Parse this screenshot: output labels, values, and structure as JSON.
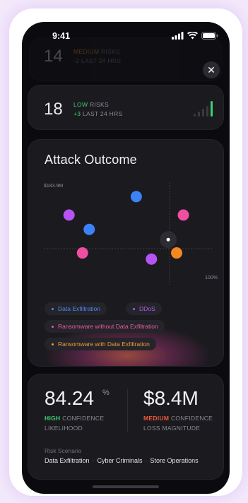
{
  "status_bar": {
    "time": "9:41"
  },
  "ghost_card": {
    "count": "14",
    "level": "MEDIUM",
    "suffix": "RISKS",
    "delta": "-2",
    "period": "LAST 24 HRS"
  },
  "low_card": {
    "count": "18",
    "level": "LOW",
    "suffix": "RISKS",
    "delta": "+3",
    "period": "LAST 24 HRS",
    "level_color": "#3ccf74"
  },
  "attack": {
    "title": "Attack Outcome",
    "y_label": "$183.9M",
    "x_label": "100%",
    "points": [
      {
        "series": "Data Exfiltration",
        "x": 0.55,
        "y": 0.86,
        "color": "#3b82f6"
      },
      {
        "series": "DDoS",
        "x": 0.15,
        "y": 0.68,
        "color": "#b653f5"
      },
      {
        "series": "Data Exfiltration",
        "x": 0.27,
        "y": 0.54,
        "color": "#3b82f6"
      },
      {
        "series": "Ransomware without Data Exfiltration",
        "x": 0.83,
        "y": 0.68,
        "color": "#ee4fa0"
      },
      {
        "series": "Ransomware without Data Exfiltration",
        "x": 0.23,
        "y": 0.31,
        "color": "#ee4fa0"
      },
      {
        "series": "DDoS",
        "x": 0.64,
        "y": 0.25,
        "color": "#b653f5"
      },
      {
        "series": "Ransomware with Data Exfiltration",
        "x": 0.79,
        "y": 0.31,
        "color": "#f5891f"
      }
    ],
    "marker": {
      "x": 0.74,
      "y": 0.44
    },
    "legend": [
      {
        "label": "Data Exfiltration",
        "color": "#4c8cf5"
      },
      {
        "label": "DDoS",
        "color": "#b35cf0"
      },
      {
        "label": "Ransomware without Data Exfiltration",
        "color": "#ec5aa6"
      },
      {
        "label": "Ransomware with Data Exfiltration",
        "color": "#f39a3a"
      }
    ]
  },
  "metrics": {
    "likelihood_value": "84.24",
    "likelihood_unit": "%",
    "likelihood_conf_level": "HIGH",
    "likelihood_conf_text": "CONFIDENCE",
    "likelihood_label": "LIKELIHOOD",
    "likelihood_color": "#3ccf74",
    "loss_value": "$8.4M",
    "loss_conf_level": "MEDIUM",
    "loss_conf_text": "CONFIDENCE",
    "loss_label": "LOSS MAGNITUDE",
    "loss_color": "#ef5a3c",
    "scenario_label": "Risk Scenario",
    "scenario_items": [
      "Data Exfiltration",
      "Cyber Criminals",
      "Store Operations"
    ]
  }
}
